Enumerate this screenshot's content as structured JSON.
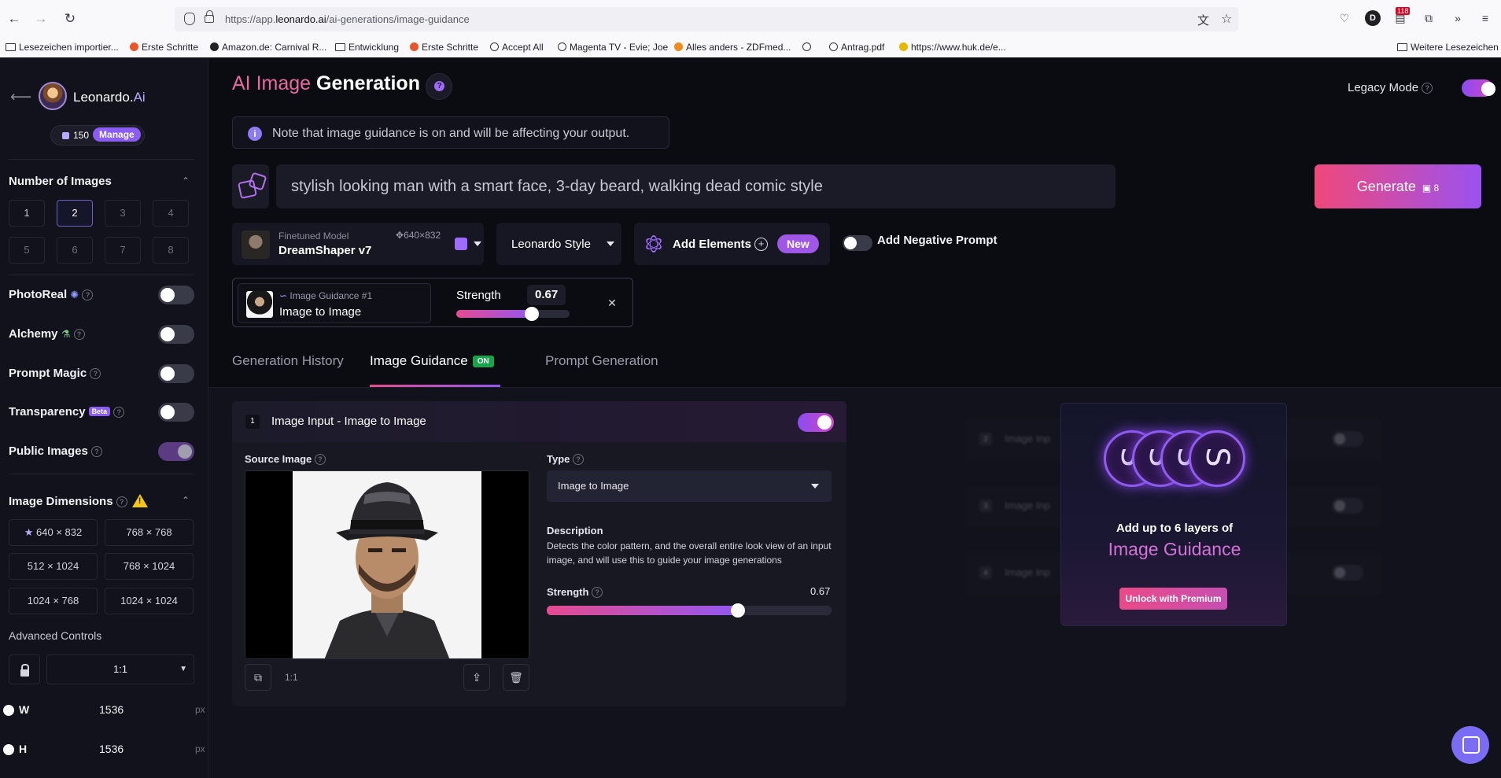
{
  "browser": {
    "url_prefix": "https://app.",
    "url_domain": "leonardo.ai",
    "url_path": "/ai-generations/image-guidance",
    "ext_badge": "118",
    "profile_initial": "D",
    "bookmarks": [
      "Lesezeichen importier...",
      "Erste Schritte",
      "Amazon.de: Carnival R...",
      "Entwicklung",
      "Erste Schritte",
      "Accept All",
      "Magenta TV - Evie; Joe",
      "Alles anders - ZDFmed...",
      "Antrag.pdf",
      "https://www.huk.de/e..."
    ],
    "other_bookmarks": "Weitere Lesezeichen"
  },
  "sidebar": {
    "brand_main": "Leonardo.",
    "brand_suffix": "Ai",
    "token_count": "150",
    "manage_label": "Manage",
    "num_images_title": "Number of Images",
    "num_options": [
      "1",
      "2",
      "3",
      "4",
      "5",
      "6",
      "7",
      "8"
    ],
    "num_selected": "2",
    "photoreal_label": "PhotoReal",
    "alchemy_label": "Alchemy",
    "prompt_magic_label": "Prompt Magic",
    "transparency_label": "Transparency",
    "beta_label": "Beta",
    "public_images_label": "Public Images",
    "dimensions_title": "Image Dimensions",
    "dimensions": [
      "640 × 832",
      "768 × 768",
      "512 × 1024",
      "768 × 1024",
      "1024 × 768",
      "1024 × 1024"
    ],
    "advanced_label": "Advanced Controls",
    "ratio": "1:1",
    "width_label": "W",
    "width_value": "1536",
    "height_label": "H",
    "height_value": "1536",
    "unit": "px"
  },
  "main": {
    "title_accent": "AI Image",
    "title_rest": " Generation",
    "legacy_label": "Legacy Mode",
    "notice": "Note that image guidance is on and will be affecting your output.",
    "prompt": "stylish looking man with a smart face, 3-day beard, walking dead comic style",
    "generate_label": "Generate",
    "generate_cost": "8",
    "model_caption": "Finetuned Model",
    "model_resolution": "640×832",
    "model_name": "DreamShaper v7",
    "style_label": "Leonardo Style",
    "elements_label": "Add Elements",
    "new_label": "New",
    "negative_label": "Add Negative Prompt",
    "guidance_chip_caption": "Image Guidance #1",
    "guidance_chip_type": "Image to Image",
    "strength_label": "Strength",
    "strength_value": "0.67",
    "strength_fraction": 0.67,
    "tabs": [
      "Generation History",
      "Image Guidance",
      "Prompt Generation"
    ],
    "on_badge": "ON"
  },
  "guidance_card": {
    "index": "1",
    "title": "Image Input - Image to Image",
    "source_label": "Source Image",
    "source_ratio": "1:1",
    "type_label": "Type",
    "type_value": "Image to Image",
    "description_label": "Description",
    "description_text": "Detects the color pattern, and the overall entire look view of an input image, and will use this to guide your image generations",
    "strength_label": "Strength",
    "strength_value": "0.67"
  },
  "ghost_rows": [
    "2",
    "3",
    "4"
  ],
  "ghost_row_label": "Image Inp",
  "premium": {
    "line1": "Add up to 6 layers of",
    "line2": "Image Guidance",
    "button": "Unlock with Premium"
  }
}
